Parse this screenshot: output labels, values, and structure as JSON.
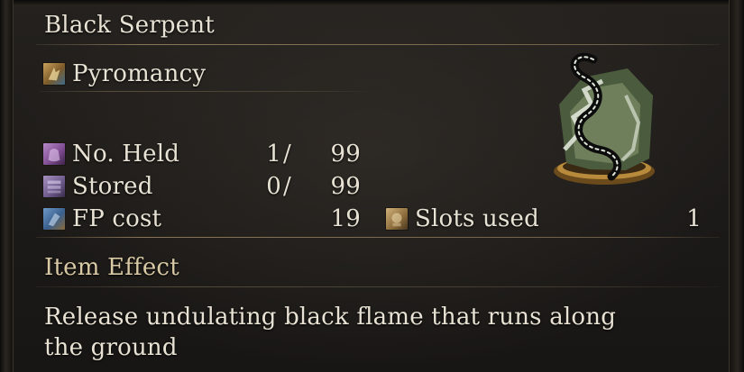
{
  "item": {
    "name": "Black Serpent",
    "category": "Pyromancy",
    "category_icon": "pyromancy-icon",
    "art_icon": "black-serpent-artwork"
  },
  "stats": {
    "held": {
      "label": "No. Held",
      "value": "1",
      "max": "99",
      "separator": "/",
      "icon": "held-pouch-icon"
    },
    "stored": {
      "label": "Stored",
      "value": "0",
      "max": "99",
      "separator": "/",
      "icon": "storage-box-icon"
    },
    "fp_cost": {
      "label": "FP cost",
      "value": "19",
      "icon": "fp-cost-icon"
    },
    "slots_used": {
      "label": "Slots used",
      "value": "1",
      "icon": "attunement-slot-icon"
    }
  },
  "effect": {
    "heading": "Item Effect",
    "line1": "Release undulating black flame that runs along",
    "line2": "the ground"
  },
  "colors": {
    "text": "#e8e2d4",
    "heading": "#d9c9a4",
    "divider": "#aa9268",
    "background": "#1c1a18"
  }
}
